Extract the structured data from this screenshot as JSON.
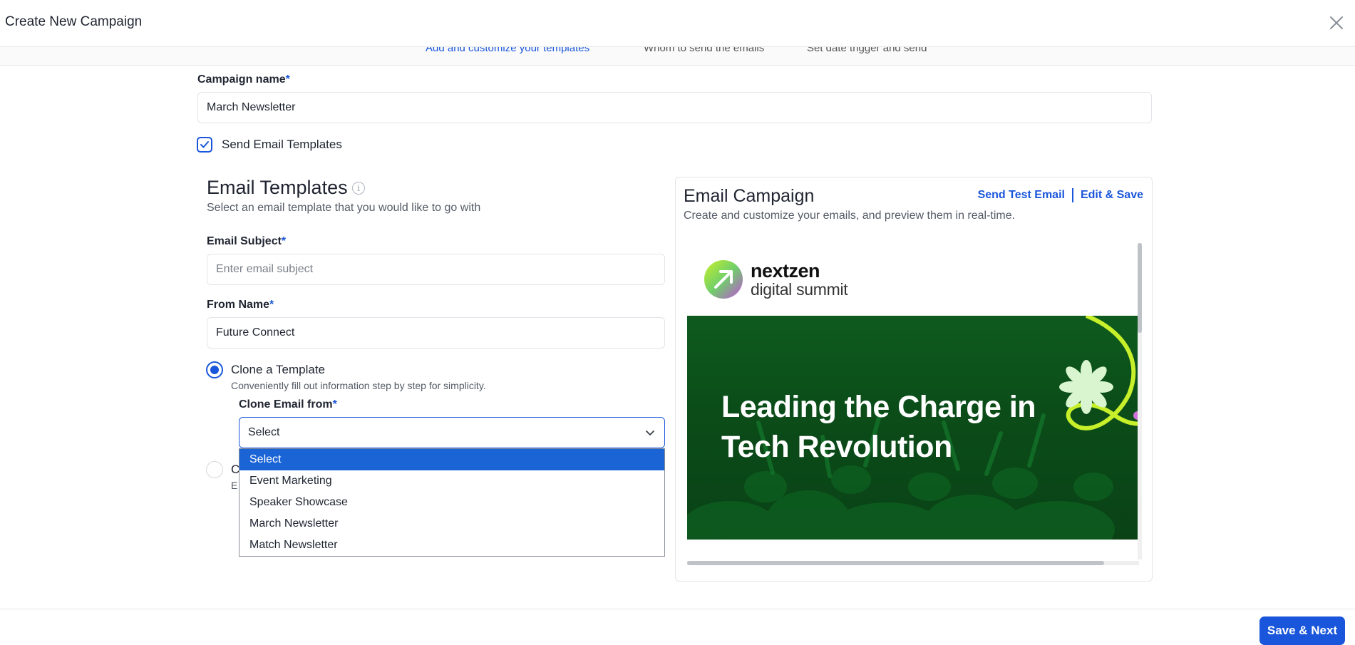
{
  "header": {
    "title": "Create New Campaign"
  },
  "stepper": {
    "steps": [
      {
        "description": "Add and customize your templates"
      },
      {
        "description": "Whom to send the emails"
      },
      {
        "description": "Set date trigger and send"
      }
    ]
  },
  "form": {
    "campaign_name_label": "Campaign name",
    "required_mark": "*",
    "campaign_name_value": "March Newsletter",
    "send_templates_label": "Send Email Templates",
    "send_templates_checked": true
  },
  "templates": {
    "title": "Email Templates",
    "subtitle": "Select an email template that you would like to go with",
    "subject_label": "Email Subject",
    "subject_placeholder": "Enter email subject",
    "from_label": "From Name",
    "from_value": "Future Connect",
    "clone_option_label": "Clone a Template",
    "clone_option_desc": "Conveniently fill out information step by step for simplicity.",
    "clone_from_label": "Clone Email from",
    "clone_select_value": "Select",
    "second_option_label_fragment": "C",
    "second_option_desc_fragment": "E",
    "dropdown_options": [
      "Select",
      "Event Marketing",
      "Speaker Showcase",
      "March Newsletter",
      "Match Newsletter"
    ],
    "dropdown_selected_index": 0
  },
  "preview": {
    "title": "Email Campaign",
    "subtitle": "Create and customize your emails, and preview them in real-time.",
    "send_test_label": "Send Test Email",
    "edit_save_label": "Edit & Save",
    "brand_name": "nextzen",
    "brand_sub": "digital summit",
    "headline": "Leading the Charge in Tech Revolution",
    "vertical_scroll_position": 0,
    "horizontal_scroll_position": 0
  },
  "footer": {
    "save_next_label": "Save & Next"
  },
  "colors": {
    "accent": "#1a56db",
    "banner_green": "#0e5b1e",
    "lime": "#c8f02a"
  }
}
